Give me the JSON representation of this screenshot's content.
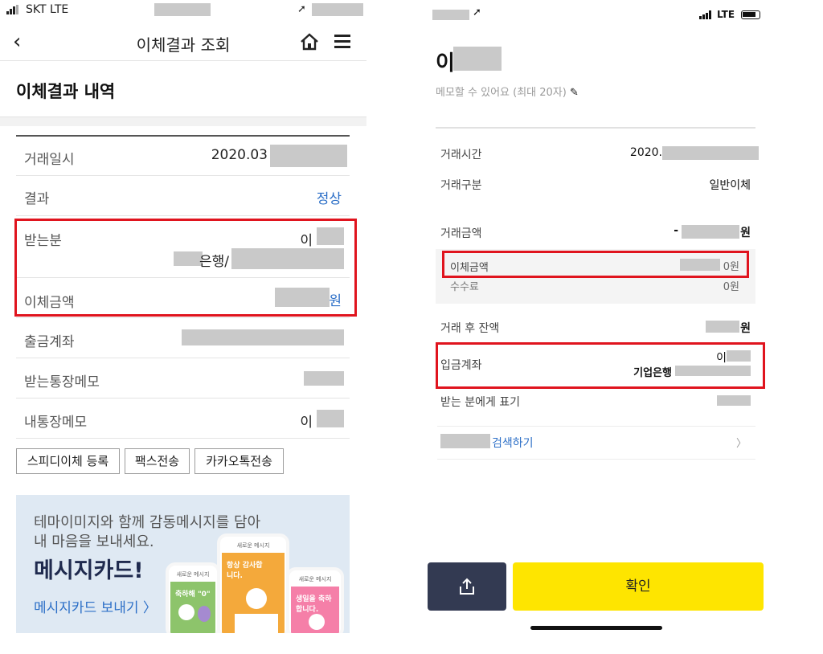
{
  "left": {
    "status": {
      "carrier": "SKT  LTE"
    },
    "nav": {
      "back": "‹",
      "title": "이체결과 조회"
    },
    "section_title": "이체결과 내역",
    "rows": {
      "date": {
        "label": "거래일시",
        "value": "2020.03"
      },
      "result": {
        "label": "결과",
        "value": "정상"
      },
      "recipient": {
        "label": "받는분",
        "name": "이",
        "bank": "은행/"
      },
      "amount": {
        "label": "이체금액",
        "unit": "원"
      },
      "from_account": {
        "label": "출금계좌"
      },
      "recipient_memo": {
        "label": "받는통장메모"
      },
      "my_memo": {
        "label": "내통장메모",
        "value": "이"
      }
    },
    "buttons": {
      "speed": "스피디이체 등록",
      "fax": "팩스전송",
      "kakao": "카카오톡전송"
    },
    "banner": {
      "line1": "테마이미지와 함께 감동메시지를 담아",
      "line2": "내 마음을 보내세요.",
      "big": "메시지카드!",
      "link": "메시지카드 보내기 〉",
      "card_header": "새로운 메시지",
      "card1_text": "축하해 \"0\"",
      "card2_text": "항상 감사합니다.",
      "card3_text": "생일을 축하합니다."
    }
  },
  "right": {
    "status": {
      "network": "LTE"
    },
    "name": "이",
    "memo": "메모할 수 있어요 (최대 20자)",
    "rows": {
      "time": {
        "label": "거래시간",
        "value": "2020."
      },
      "type": {
        "label": "거래구분",
        "value": "일반이체"
      },
      "amount": {
        "label": "거래금액",
        "prefix": "-",
        "unit": "원"
      },
      "transfer_amount": {
        "label": "이체금액",
        "value": "0원"
      },
      "fee": {
        "label": "수수료",
        "value": "0원"
      },
      "balance": {
        "label": "거래 후 잔액",
        "unit": "원"
      },
      "deposit": {
        "label": "입금계좌",
        "name": "이",
        "bank": "기업은행"
      },
      "shown_to_recipient": {
        "label": "받는 분에게 표기"
      }
    },
    "search": {
      "label": "검색하기",
      "chevron": "〉"
    },
    "confirm": "확인"
  },
  "colors": {
    "highlight": "#e0141e",
    "kakao_yellow": "#fee500",
    "link_blue": "#2c6fc7",
    "share_dark": "#333a52"
  }
}
